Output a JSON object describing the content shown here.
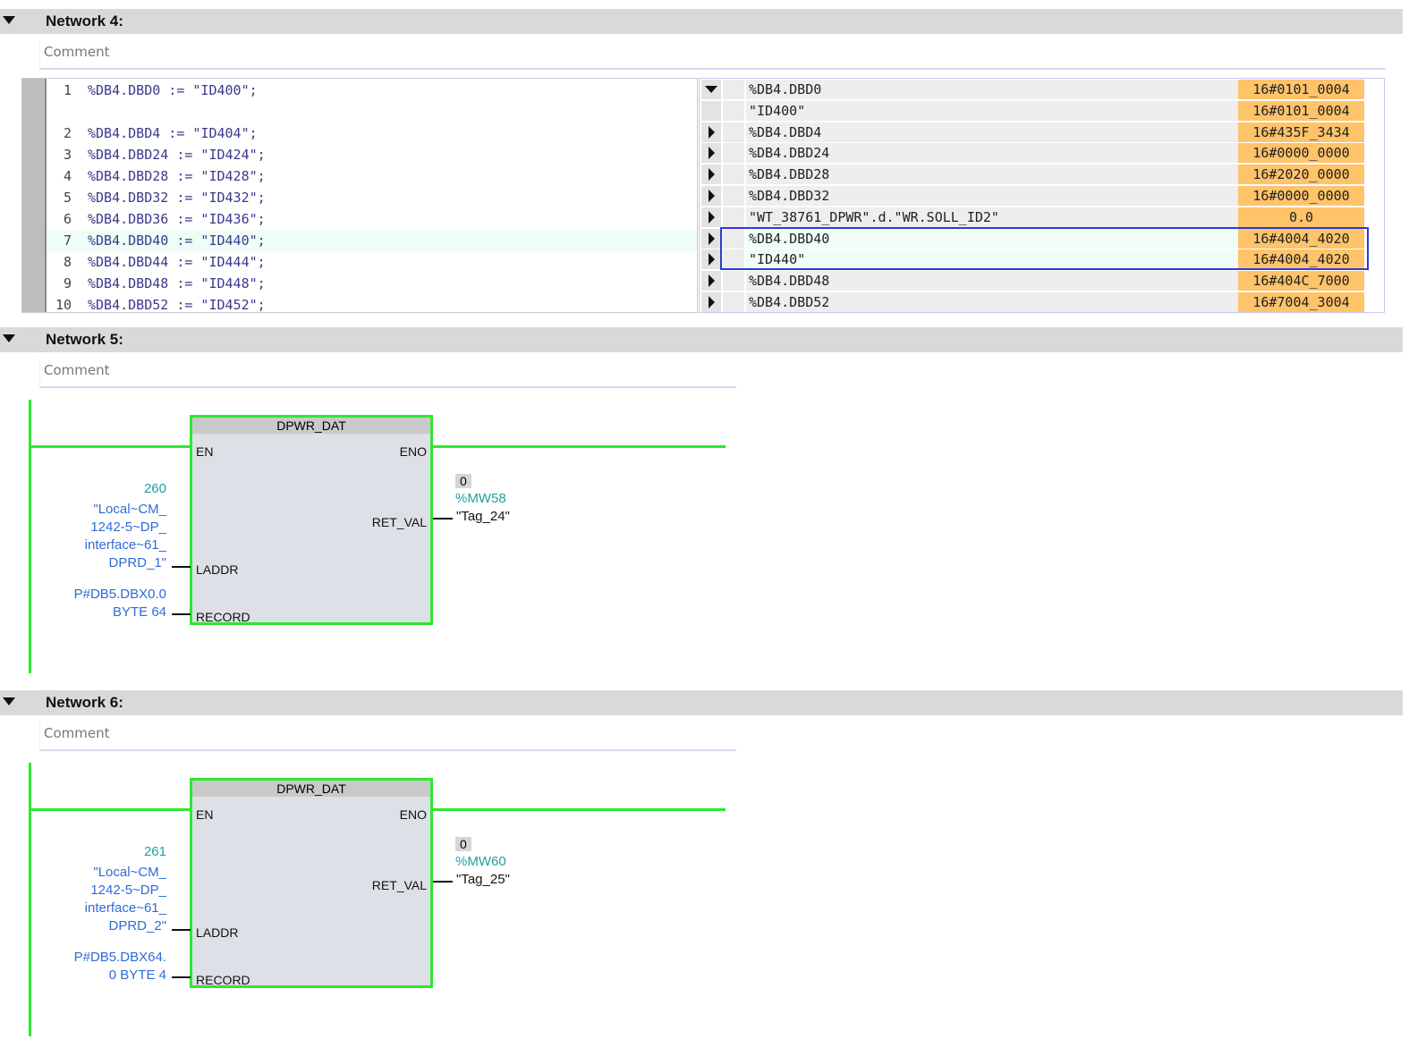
{
  "networks": [
    {
      "title": "Network 4:",
      "comment": "Comment",
      "code": [
        {
          "n": "1",
          "t": "%DB4.DBD0 := \"ID400\";"
        },
        {
          "n": "2",
          "t": "%DB4.DBD4 := \"ID404\";"
        },
        {
          "n": "3",
          "t": "%DB4.DBD24 := \"ID424\";"
        },
        {
          "n": "4",
          "t": "%DB4.DBD28 := \"ID428\";"
        },
        {
          "n": "5",
          "t": "%DB4.DBD32 := \"ID432\";"
        },
        {
          "n": "6",
          "t": "%DB4.DBD36 := \"ID436\";"
        },
        {
          "n": "7",
          "t": "%DB4.DBD40 := \"ID440\";"
        },
        {
          "n": "8",
          "t": "%DB4.DBD44 := \"ID444\";"
        },
        {
          "n": "9",
          "t": "%DB4.DBD48 := \"ID448\";"
        },
        {
          "n": "10",
          "t": "%DB4.DBD52 := \"ID452\";"
        }
      ],
      "watch": [
        {
          "name": "%DB4.DBD0",
          "value": "16#0101_0004",
          "expander": "down"
        },
        {
          "name": "\"ID400\"",
          "value": "16#0101_0004",
          "expander": "none"
        },
        {
          "name": "%DB4.DBD4",
          "value": "16#435F_3434",
          "expander": "right"
        },
        {
          "name": "%DB4.DBD24",
          "value": "16#0000_0000",
          "expander": "right"
        },
        {
          "name": "%DB4.DBD28",
          "value": "16#2020_0000",
          "expander": "right"
        },
        {
          "name": "%DB4.DBD32",
          "value": "16#0000_0000",
          "expander": "right"
        },
        {
          "name": "\"WT_38761_DPWR\".d.\"WR.SOLL_ID2\"",
          "value": "0.0",
          "expander": "right"
        },
        {
          "name": "%DB4.DBD40",
          "value": "16#4004_4020",
          "expander": "right"
        },
        {
          "name": "\"ID440\"",
          "value": "16#4004_4020",
          "expander": "right"
        },
        {
          "name": "%DB4.DBD48",
          "value": "16#404C_7000",
          "expander": "right"
        },
        {
          "name": "%DB4.DBD52",
          "value": "16#7004_3004",
          "expander": "right"
        }
      ]
    },
    {
      "title": "Network 5:",
      "comment": "Comment",
      "block": "DPWR_DAT",
      "pins": {
        "en": "EN",
        "eno": "ENO",
        "ret_val": "RET_VAL",
        "laddr": "LADDR",
        "record": "RECORD"
      },
      "laddr_value": "260",
      "laddr_lines": [
        "\"Local~CM_",
        "1242-5~DP_",
        "interface~61_",
        "DPRD_1\""
      ],
      "record_lines": [
        "P#DB5.DBX0.0",
        "BYTE 64"
      ],
      "ret_live": "0",
      "ret_addr": "%MW58",
      "ret_tag": "\"Tag_24\""
    },
    {
      "title": "Network 6:",
      "comment": "Comment",
      "block": "DPWR_DAT",
      "pins": {
        "en": "EN",
        "eno": "ENO",
        "ret_val": "RET_VAL",
        "laddr": "LADDR",
        "record": "RECORD"
      },
      "laddr_value": "261",
      "laddr_lines": [
        "\"Local~CM_",
        "1242-5~DP_",
        "interface~61_",
        "DPRD_2\""
      ],
      "record_lines": [
        "P#DB5.DBX64.",
        "0 BYTE 4"
      ],
      "ret_live": "0",
      "ret_addr": "%MW60",
      "ret_tag": "\"Tag_25\""
    }
  ],
  "colors": {
    "energized": "#2ee82e",
    "monitor_value": "#ffc36a",
    "selection": "#2b3bd6"
  }
}
